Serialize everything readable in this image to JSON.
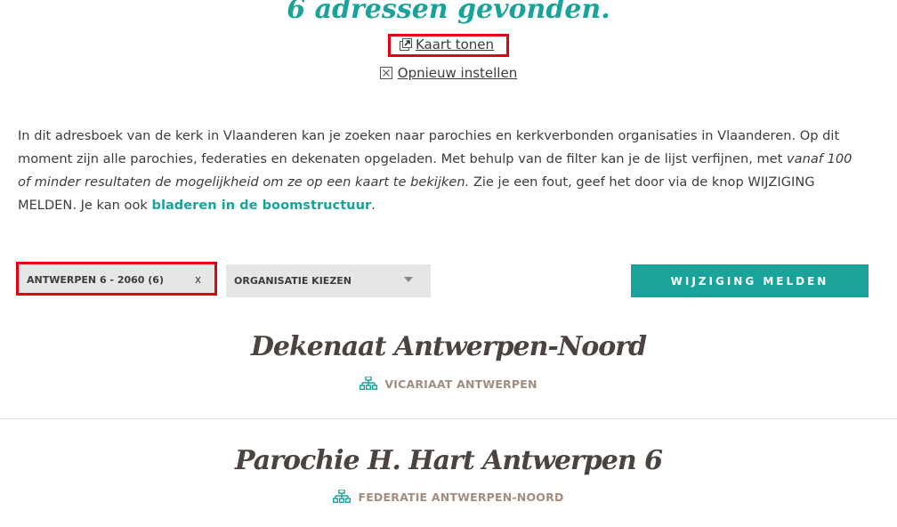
{
  "page": {
    "heading": "6 adressen gevonden."
  },
  "actions": {
    "map_link": "Kaart tonen",
    "reset_link": "Opnieuw instellen"
  },
  "intro": {
    "part1": "In dit adresboek van de kerk in Vlaanderen kan je zoeken naar parochies en kerkverbonden organisaties in Vlaanderen. Op dit moment zijn alle parochies, federaties en dekenaten opgeladen. Met behulp van de filter kan je de lijst verfijnen, met ",
    "emphasis": "vanaf 100 of minder resultaten de mogelijkheid om ze op een kaart te bekijken.",
    "part2": " Zie je een fout, geef het door via de knop WIJZIGING MELDEN. Je kan ook ",
    "link": "bladeren in de boomstructuur",
    "part3": "."
  },
  "filters": {
    "active_chip": "ANTWERPEN 6 - 2060 (6)",
    "chip_remove": "x",
    "organisation_select": "ORGANISATIE KIEZEN"
  },
  "report_button": "WIJZIGING MELDEN",
  "results": [
    {
      "title": "Dekenaat Antwerpen-Noord",
      "parent": "VICARIAAT ANTWERPEN"
    },
    {
      "title": "Parochie H. Hart Antwerpen 6",
      "parent": "FEDERATIE ANTWERPEN-NOORD"
    }
  ],
  "icons": {
    "map": "external-link-icon",
    "reset": "close-box-icon",
    "hierarchy": "sitemap-icon",
    "dropdown": "caret-down-icon"
  },
  "colors": {
    "accent": "#1aa39a",
    "highlight": "#e3000f",
    "subtitle": "#a38d7f",
    "title": "#4a4340",
    "chip_bg": "#e6e6e6"
  }
}
